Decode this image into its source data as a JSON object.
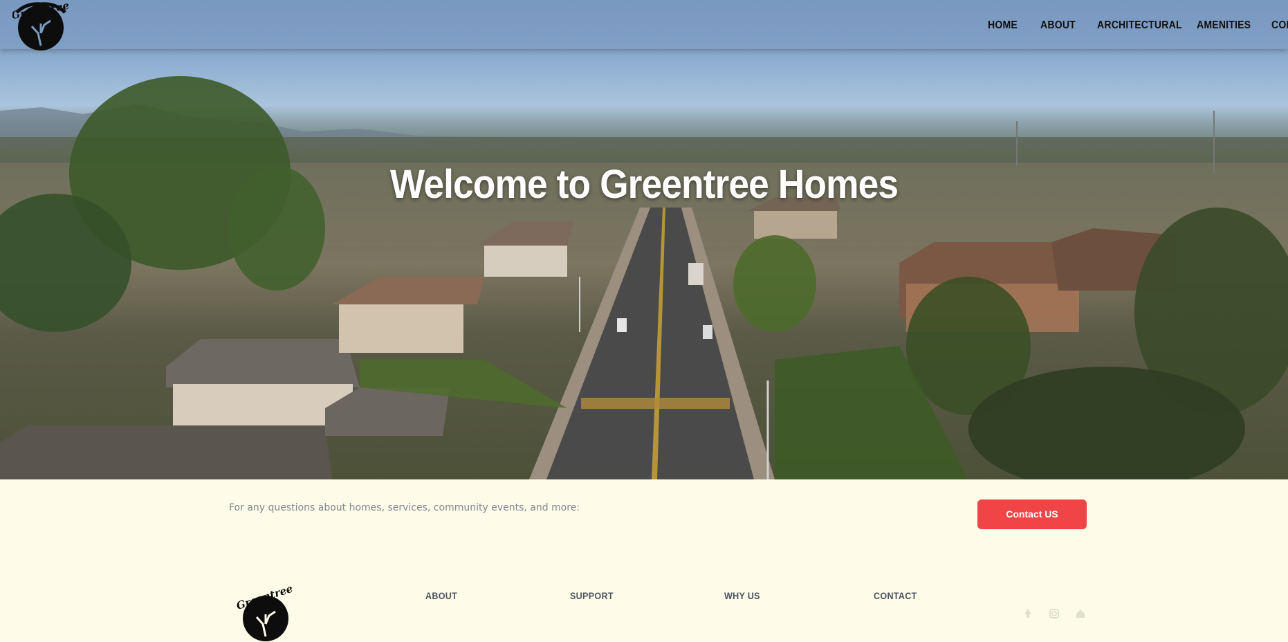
{
  "brand": {
    "logo_text": "Greentree",
    "logo_icon": "tree-logo-icon"
  },
  "nav": {
    "items": [
      "HOME",
      "ABOUT",
      "ARCHITECTURAL",
      "AMENITIES",
      "CON"
    ]
  },
  "hero": {
    "title": "Welcome to Greentree Homes"
  },
  "contact": {
    "text": "For any questions about homes, services, community events, and more:",
    "button_label": "Contact US"
  },
  "footer": {
    "links": [
      "ABOUT",
      "SUPPORT",
      "WHY US",
      "CONTACT"
    ],
    "social_icons": [
      "facebook-icon",
      "instagram-icon",
      "home-icon"
    ]
  },
  "colors": {
    "background": "#fefbe8",
    "accent": "#ef4547",
    "nav_text": "#111111",
    "footer_text": "#4a5361"
  }
}
